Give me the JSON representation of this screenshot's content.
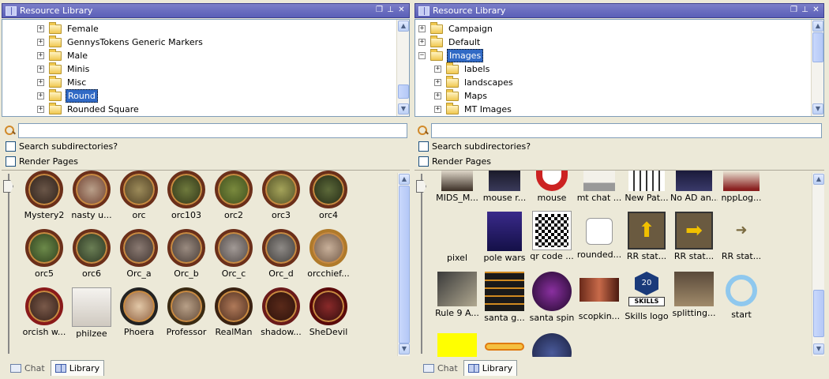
{
  "colors": {
    "title_bar": "#5a5fb8",
    "selection": "#316ac5",
    "panel_bg": "#ece9d8"
  },
  "left": {
    "title": "Resource Library",
    "tree": [
      {
        "label": "Female",
        "selected": false
      },
      {
        "label": "GennysTokens Generic Markers",
        "selected": false
      },
      {
        "label": "Male",
        "selected": false
      },
      {
        "label": "Minis",
        "selected": false
      },
      {
        "label": "Misc",
        "selected": false
      },
      {
        "label": "Round",
        "selected": true
      },
      {
        "label": "Rounded Square",
        "selected": false
      }
    ],
    "search": {
      "value": "",
      "placeholder": ""
    },
    "search_subdirs_label": "Search subdirectories?",
    "render_pages_label": "Render Pages",
    "images": [
      "Mystery2",
      "nasty u...",
      "orc",
      "orc103",
      "orc2",
      "orc3",
      "orc4",
      "orc5",
      "orc6",
      "Orc_a",
      "Orc_b",
      "Orc_c",
      "Orc_d",
      "orcchief...",
      "orcish w...",
      "philzee",
      "Phoera",
      "Professor",
      "RealMan",
      "shadow...",
      "SheDevil"
    ],
    "tabs": [
      {
        "label": "Chat",
        "active": false
      },
      {
        "label": "Library",
        "active": true
      }
    ]
  },
  "right": {
    "title": "Resource Library",
    "tree": [
      {
        "label": "Campaign",
        "selected": false,
        "indent": 0,
        "expanded": false
      },
      {
        "label": "Default",
        "selected": false,
        "indent": 0,
        "expanded": false
      },
      {
        "label": "Images",
        "selected": true,
        "indent": 0,
        "expanded": true
      },
      {
        "label": "labels",
        "selected": false,
        "indent": 1,
        "expanded": false
      },
      {
        "label": "landscapes",
        "selected": false,
        "indent": 1,
        "expanded": false
      },
      {
        "label": "Maps",
        "selected": false,
        "indent": 1,
        "expanded": false
      },
      {
        "label": "MT Images",
        "selected": false,
        "indent": 1,
        "expanded": false
      }
    ],
    "search": {
      "value": "",
      "placeholder": ""
    },
    "search_subdirs_label": "Search subdirectories?",
    "render_pages_label": "Render Pages",
    "images": [
      "MIDS_M...",
      "mouse r...",
      "mouse",
      "mt chat ...",
      "New Pat...",
      "No AD an...",
      "nppLog...",
      "pixel",
      "pole wars",
      "qr code ...",
      "rounded...",
      "RR stat...",
      "RR stat...",
      "RR stat...",
      "Rule 9 A...",
      "santa g...",
      "santa spin",
      "scopkin...",
      "Skills logo",
      "splitting...",
      "start"
    ],
    "skills_badge": {
      "number": "20",
      "text": "SKILLS"
    },
    "tabs": [
      {
        "label": "Chat",
        "active": false
      },
      {
        "label": "Library",
        "active": true
      }
    ]
  }
}
